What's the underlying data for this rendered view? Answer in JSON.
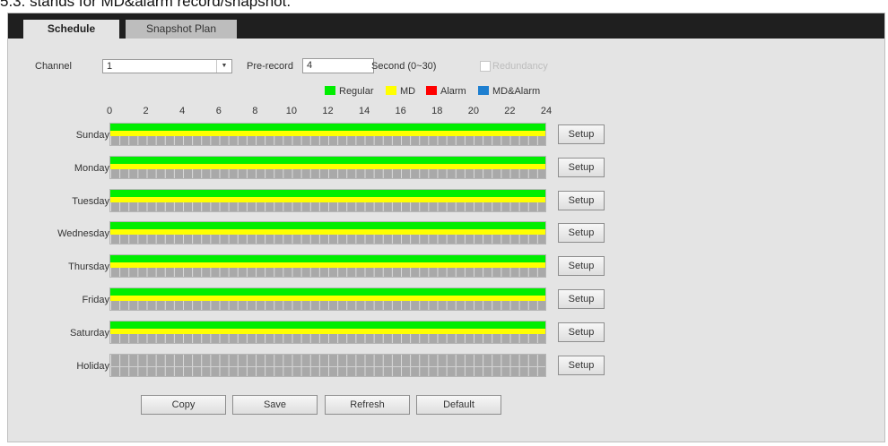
{
  "caption": "5.3. stands for MD&alarm record/snapshot.",
  "tabs": [
    {
      "label": "Schedule",
      "active": true
    },
    {
      "label": "Snapshot Plan",
      "active": false
    }
  ],
  "form": {
    "channel_label": "Channel",
    "channel_value": "1",
    "prerecord_label": "Pre-record",
    "prerecord_value": "4",
    "second_label": "Second (0~30)",
    "redundancy_label": "Redundancy",
    "redundancy_checked": false
  },
  "legend": [
    {
      "label": "Regular",
      "color": "#00ee00"
    },
    {
      "label": "MD",
      "color": "#ffff00"
    },
    {
      "label": "Alarm",
      "color": "#ff0000"
    },
    {
      "label": "MD&Alarm",
      "color": "#1e7fd0"
    }
  ],
  "hours": [
    "0",
    "2",
    "4",
    "6",
    "8",
    "10",
    "12",
    "14",
    "16",
    "18",
    "20",
    "22",
    "24"
  ],
  "days": [
    {
      "label": "Sunday",
      "regular": true,
      "md": true
    },
    {
      "label": "Monday",
      "regular": true,
      "md": true
    },
    {
      "label": "Tuesday",
      "regular": true,
      "md": true
    },
    {
      "label": "Wednesday",
      "regular": true,
      "md": true
    },
    {
      "label": "Thursday",
      "regular": true,
      "md": true
    },
    {
      "label": "Friday",
      "regular": true,
      "md": true
    },
    {
      "label": "Saturday",
      "regular": true,
      "md": true
    },
    {
      "label": "Holiday",
      "regular": false,
      "md": false
    }
  ],
  "setup_label": "Setup",
  "buttons": {
    "copy": "Copy",
    "save": "Save",
    "refresh": "Refresh",
    "default": "Default"
  }
}
